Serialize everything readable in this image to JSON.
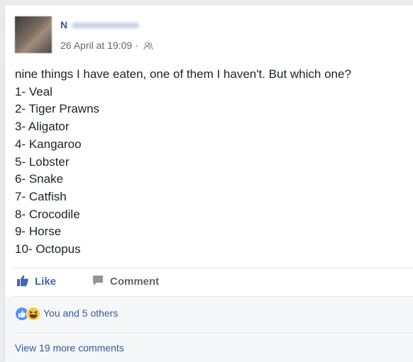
{
  "post": {
    "author_visible_initial": "N",
    "timestamp": "26 April at 19:09",
    "separator": "·",
    "audience_icon": "friends-icon",
    "intro": "nine things I have eaten, one of them I haven't. But which one?",
    "items": [
      "1- Veal",
      "2- Tiger Prawns",
      "3- Aligator",
      "4- Kangaroo",
      "5- Lobster",
      "6- Snake",
      "7- Catfish",
      "8- Crocodile",
      "9- Horse",
      "10- Octopus"
    ]
  },
  "actions": {
    "like_label": "Like",
    "comment_label": "Comment"
  },
  "reactions": {
    "summary": "You and 5 others",
    "icons": [
      "like-reaction-icon",
      "haha-reaction-icon"
    ]
  },
  "comments": {
    "view_more": "View 19 more comments"
  },
  "colors": {
    "link_blue": "#365899",
    "like_blue": "#4267b2",
    "meta_grey": "#616770",
    "text": "#1d2129",
    "page_bg": "#e9ebee"
  }
}
